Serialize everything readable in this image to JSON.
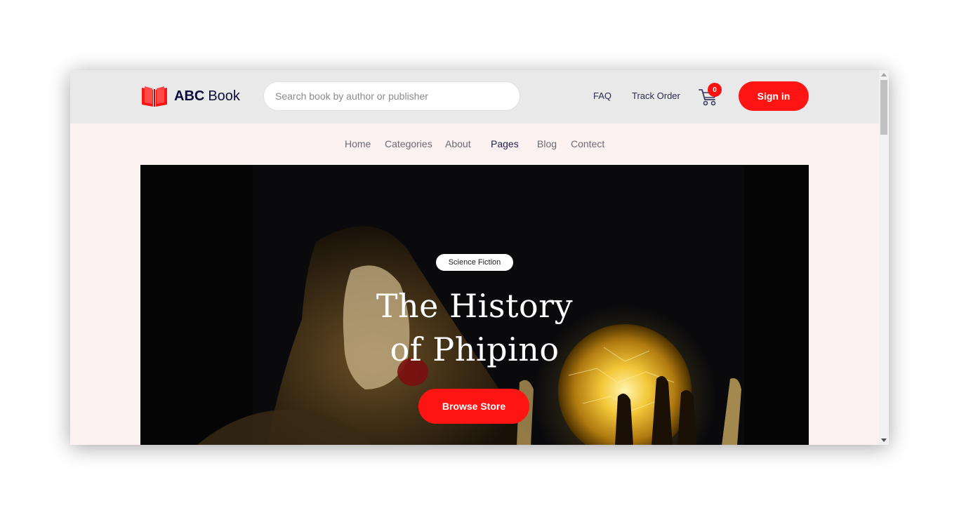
{
  "brand": {
    "bold": "ABC",
    "light": "Book",
    "icon": "open-book-icon",
    "color": "#ff1414"
  },
  "search": {
    "placeholder": "Search book by author or publisher",
    "value": ""
  },
  "header_links": {
    "faq": "FAQ",
    "track_order": "Track Order"
  },
  "cart": {
    "icon": "cart-icon",
    "count": "0"
  },
  "signin": {
    "label": "Sign in"
  },
  "menu": {
    "items": [
      {
        "label": "Home"
      },
      {
        "label": "Categories"
      },
      {
        "label": "About"
      },
      {
        "label": "Pages",
        "active": true
      },
      {
        "label": "Blog"
      },
      {
        "label": "Contect"
      }
    ]
  },
  "hero": {
    "tag": "Science Fiction",
    "title_line1": "The History",
    "title_line2": "of Phipino",
    "button": "Browse Store"
  },
  "colors": {
    "accent": "#ff1414",
    "navy": "#0c0d3a",
    "page_bg": "#fcf2f2",
    "header_bg": "#e9e9ea"
  }
}
